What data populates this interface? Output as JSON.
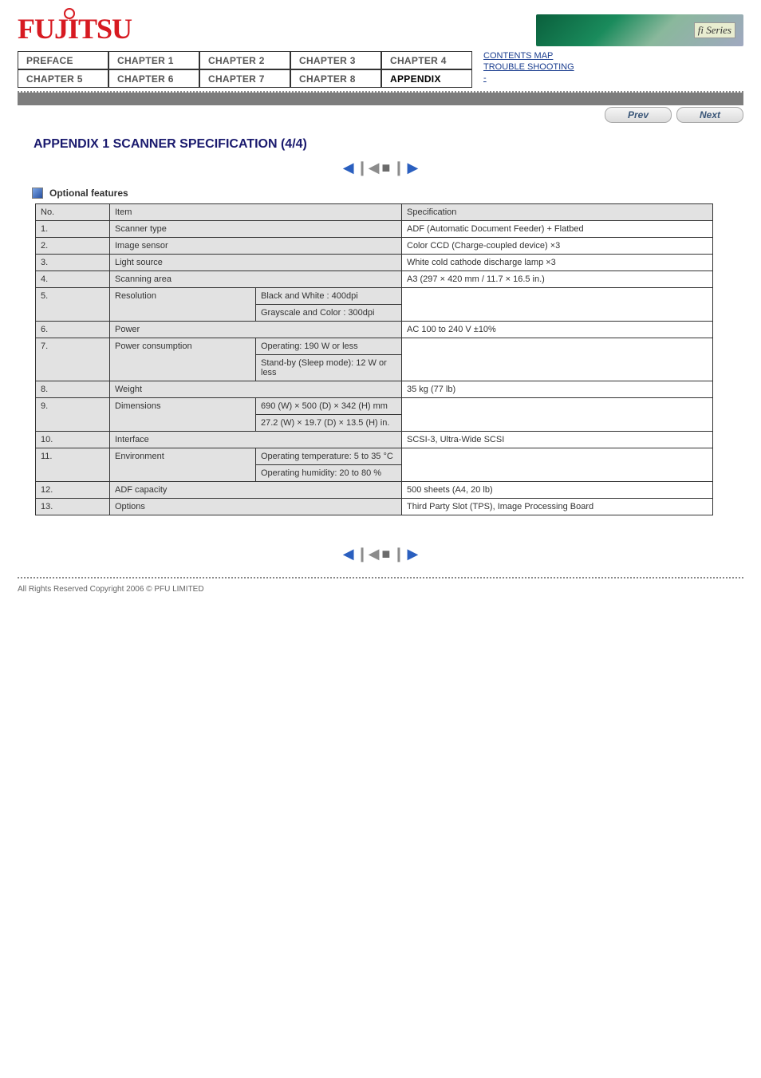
{
  "brand": {
    "logo": "FUJITSU",
    "banner_badge": "fi Series"
  },
  "nav": {
    "row1": [
      "PREFACE",
      "CHAPTER 1",
      "CHAPTER 2",
      "CHAPTER 3",
      "CHAPTER 4"
    ],
    "row2": [
      "CHAPTER 5",
      "CHAPTER 6",
      "CHAPTER 7",
      "CHAPTER 8",
      "APPENDIX"
    ],
    "side": [
      "CONTENTS MAP",
      "TROUBLE SHOOTING",
      "-"
    ]
  },
  "pager": {
    "prev": "Prev",
    "next": "Next"
  },
  "page_title": "APPENDIX 1 SCANNER SPECIFICATION (4/4)",
  "section": "Optional features",
  "table": {
    "head": [
      "No.",
      "Item",
      "Specification"
    ],
    "rows": [
      [
        "1.",
        "Scanner type",
        "ADF (Automatic Document Feeder) + Flatbed"
      ],
      [
        "2.",
        "Image sensor",
        "Color CCD (Charge-coupled device) ×3"
      ],
      [
        "3.",
        "Light source",
        "White cold cathode discharge lamp ×3"
      ],
      [
        "4.",
        "Scanning area",
        "A3 (297 × 420 mm / 11.7 × 16.5 in.)"
      ],
      [
        "5.",
        "Resolution",
        "Black and White : 400dpi",
        "Grayscale and Color : 300dpi"
      ],
      [
        "6.",
        "Power",
        "AC 100 to 240 V ±10%"
      ],
      [
        "7.",
        "Power consumption",
        "Operating: 190 W or less",
        "Stand-by (Sleep mode): 12 W or less"
      ],
      [
        "8.",
        "Weight",
        "35 kg (77 lb)"
      ],
      [
        "9.",
        "Dimensions",
        "690 (W) × 500 (D) × 342 (H) mm",
        "27.2 (W) × 19.7 (D) × 13.5 (H) in."
      ],
      [
        "10.",
        "Interface",
        "SCSI-3, Ultra-Wide SCSI"
      ],
      [
        "11.",
        "Environment",
        "Operating temperature: 5 to 35 °C",
        "Operating humidity: 20 to 80 %"
      ],
      [
        "12.",
        "ADF capacity",
        "500 sheets (A4, 20 lb)",
        ""
      ],
      [
        "13.",
        "Options",
        "Third Party Slot (TPS), Image Processing Board",
        ""
      ]
    ]
  },
  "copyright": "All Rights Reserved Copyright 2006 © PFU LIMITED"
}
